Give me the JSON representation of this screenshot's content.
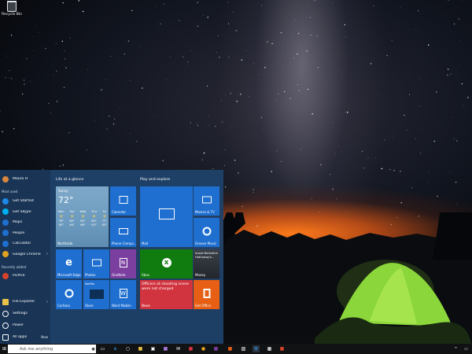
{
  "desktop": {
    "recycle_bin_label": "Recycle Bin"
  },
  "start": {
    "user": "Mauro H",
    "most_used_label": "Most used",
    "recently_added_label": "Recently added",
    "most_used": [
      {
        "label": "Get Started",
        "icon": "lightbulb-icon",
        "color": "#1e88e5"
      },
      {
        "label": "Get Skype",
        "icon": "skype-icon",
        "color": "#00aff0"
      },
      {
        "label": "Maps",
        "icon": "maps-icon",
        "color": "#1e6fd0"
      },
      {
        "label": "People",
        "icon": "people-icon",
        "color": "#1e6fd0"
      },
      {
        "label": "Calculator",
        "icon": "calculator-icon",
        "color": "#1e6fd0"
      },
      {
        "label": "Google Chrome",
        "icon": "chrome-icon",
        "color": "#e0a020"
      }
    ],
    "recently_added": [
      {
        "label": "PicPick",
        "icon": "picpick-icon",
        "color": "#d7412b"
      }
    ],
    "bottom": [
      {
        "label": "File Explorer",
        "icon": "folder-icon"
      },
      {
        "label": "Settings",
        "icon": "gear-icon"
      },
      {
        "label": "Power",
        "icon": "power-icon"
      },
      {
        "label": "All apps",
        "icon": "apps-icon",
        "badge": "New"
      }
    ],
    "group_life": "Life at a glance",
    "group_play": "Play and explore",
    "weather": {
      "condition": "Sunny",
      "temp": "72°",
      "location": "Northside",
      "days": [
        {
          "day": "Mon",
          "hi": "78°",
          "lo": "65°"
        },
        {
          "day": "Tue",
          "hi": "80°",
          "lo": "64°"
        },
        {
          "day": "Wed",
          "hi": "80°",
          "lo": "66°"
        },
        {
          "day": "Thu",
          "hi": "80°",
          "lo": "63°"
        },
        {
          "day": "Fri",
          "hi": "77°",
          "lo": "63°"
        }
      ]
    },
    "tiles": {
      "calendar": "Calendar",
      "phone": "Phone Compa...",
      "mail": "Mail",
      "movies": "Movies & TV",
      "xbox": "Xbox",
      "groove": "Groove Music",
      "edge": "Microsoft Edge",
      "photos": "Photos",
      "onenote": "OneNote",
      "cortana": "Cortana",
      "netflix": "Netflix",
      "store": "Store",
      "word": "Word Mobile",
      "news_headline": "Officers at shooting scene were not charged",
      "news": "News",
      "money_headline": "Inside Berkshire Hathaway's...",
      "money": "Money",
      "office": "Get Office"
    }
  },
  "taskbar": {
    "search_placeholder": "Ask me anything"
  },
  "colors": {
    "start_bg": "#1f4269",
    "tile_blue": "#1e6fd0",
    "xbox_green": "#107c10",
    "onenote": "#7b3fa0",
    "news_red": "#d1343e",
    "office_orange": "#e65f14"
  }
}
